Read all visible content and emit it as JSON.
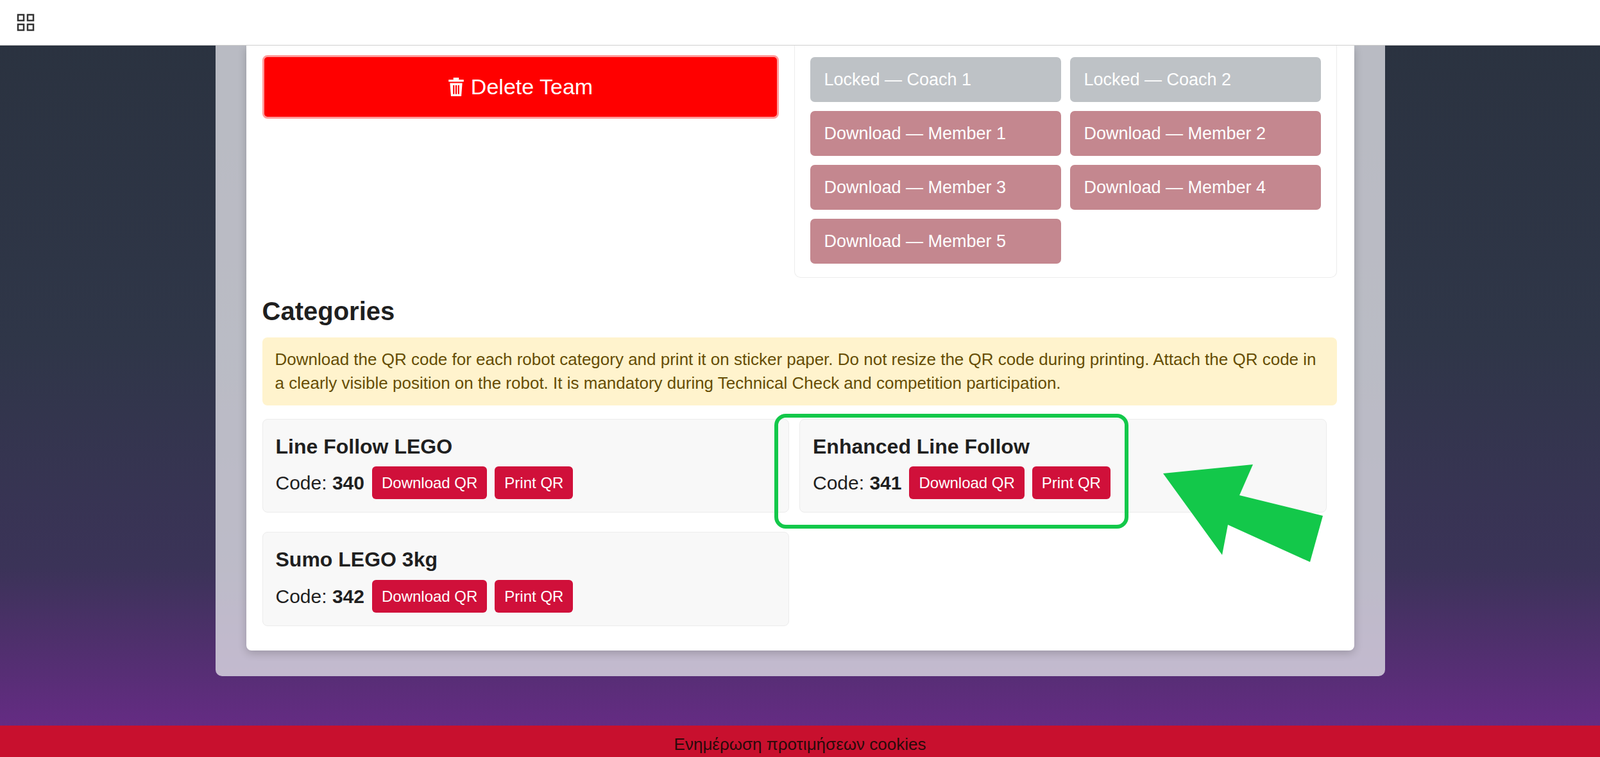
{
  "delete_button": {
    "label": "Delete Team"
  },
  "downloads": [
    {
      "label": "Locked — Coach 1",
      "locked": true
    },
    {
      "label": "Locked — Coach 2",
      "locked": true
    },
    {
      "label": "Download — Member 1",
      "locked": false
    },
    {
      "label": "Download — Member 2",
      "locked": false
    },
    {
      "label": "Download — Member 3",
      "locked": false
    },
    {
      "label": "Download — Member 4",
      "locked": false
    },
    {
      "label": "Download — Member 5",
      "locked": false
    }
  ],
  "categories_section": {
    "title": "Categories",
    "notice": "Download the QR code for each robot category and print it on sticker paper. Do not resize the QR code during printing. Attach the QR code in a clearly visible position on the robot. It is mandatory during Technical Check and competition participation."
  },
  "category_labels": {
    "code": "Code:",
    "download": "Download QR",
    "print": "Print QR"
  },
  "categories": [
    {
      "name": "Line Follow LEGO",
      "code": "340",
      "highlighted": false
    },
    {
      "name": "Enhanced Line Follow",
      "code": "341",
      "highlighted": true
    },
    {
      "name": "Sumo LEGO 3kg",
      "code": "342",
      "highlighted": false
    }
  ],
  "cookie_bar": {
    "label": "Ενημέρωση προτιμήσεων cookies"
  }
}
